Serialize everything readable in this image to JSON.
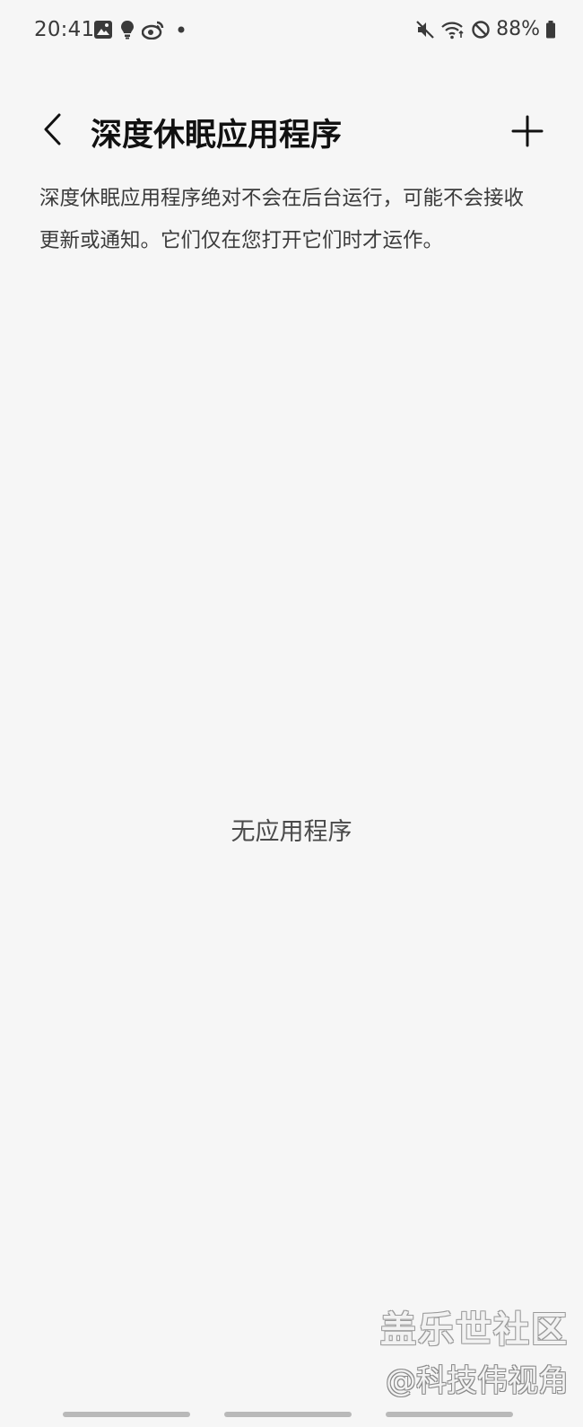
{
  "status_bar": {
    "time": "20:41",
    "left_icons": [
      "gallery-icon",
      "bulb-icon",
      "weibo-icon",
      "dot-icon"
    ],
    "right_icons": [
      "mute-icon",
      "wifi-icon",
      "do-not-disturb-icon",
      "battery-icon"
    ],
    "battery_percent": "88%"
  },
  "header": {
    "title": "深度休眠应用程序",
    "back_icon": "chevron-left-icon",
    "add_icon": "plus-icon"
  },
  "description": "深度休眠应用程序绝对不会在后台运行，可能不会接收更新或通知。它们仅在您打开它们时才运作。",
  "empty_state": "无应用程序",
  "watermark": {
    "line1": "盖乐世社区",
    "line2": "@科技伟视角"
  },
  "colors": {
    "background": "#f6f6f6",
    "text_primary": "#111111",
    "text_secondary": "#3b3b3b",
    "nav_pill": "#b9b9b9"
  }
}
